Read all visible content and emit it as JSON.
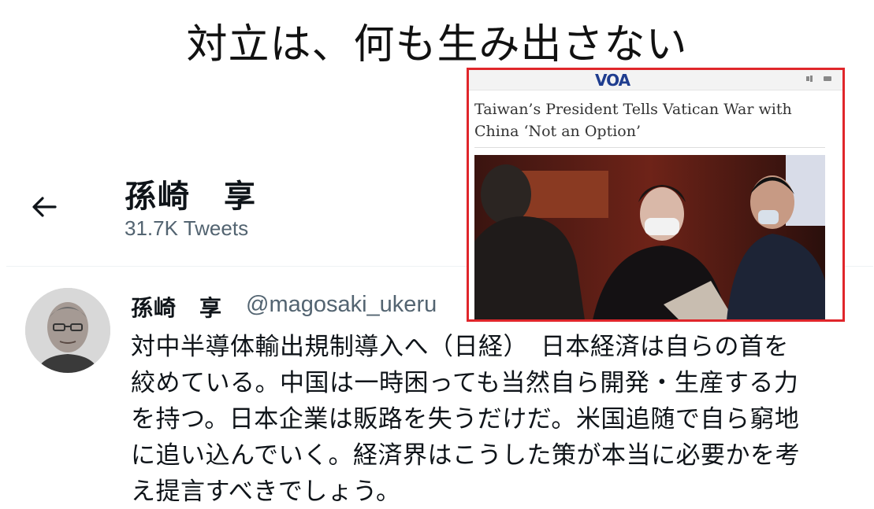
{
  "slide": {
    "title": "対立は、何も生み出さない"
  },
  "profile": {
    "name": "孫崎　享",
    "tweets_count": "31.7K Tweets"
  },
  "tweet": {
    "author_name": "孫崎　享",
    "handle": "@magosaki_ukeru",
    "lines": [
      "対中半導体輸出規制導入へ（日経）　日本経済は自らの首を",
      "絞めている。中国は一時困っても当然自ら開発・生産する力",
      "を持つ。日本企業は販路を失うだけだ。米国追随で自ら窮地",
      "に追い込んでいく。経済界はこうした策が本当に必要かを考",
      "え提言すべきでしょう。"
    ]
  },
  "voa": {
    "logo": "VOA",
    "headline_line1": "Taiwan’s President Tells Vatican War with",
    "headline_line2": "China ‘Not an Option’"
  },
  "colors": {
    "highlight_border": "#e0262b",
    "secondary_text": "#536471",
    "voa_blue": "#1f3d8f"
  },
  "icons": {
    "back": "back-arrow-icon"
  }
}
